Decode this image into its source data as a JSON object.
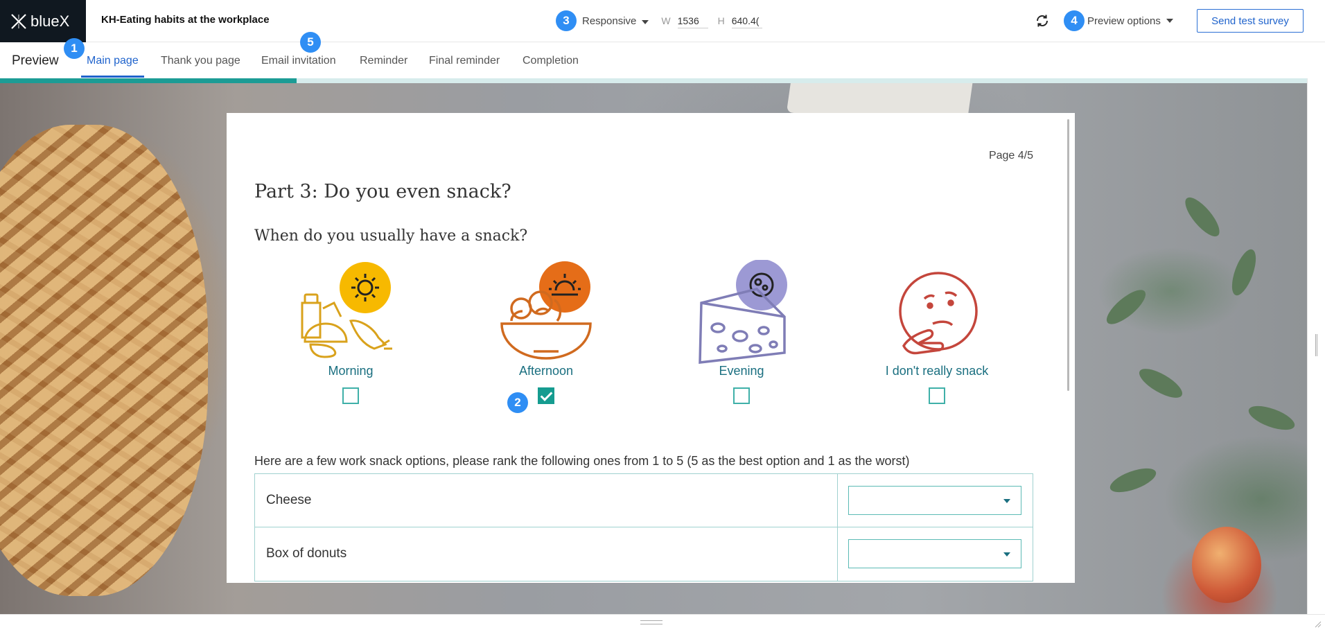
{
  "app": {
    "logo_text": "blueX",
    "survey_title": "KH-Eating habits at the workplace"
  },
  "header": {
    "device_mode": "Responsive",
    "width_label": "W",
    "width_value": "1536",
    "height_label": "H",
    "height_value": "640.4(",
    "preview_options_label": "Preview options",
    "send_test_label": "Send test survey",
    "refresh_icon": "refresh-icon"
  },
  "badges": {
    "b1": "1",
    "b2": "2",
    "b3": "3",
    "b4": "4",
    "b5": "5"
  },
  "tabs": {
    "preview_label": "Preview",
    "items": [
      {
        "label": "Main page",
        "active": true
      },
      {
        "label": "Thank you page",
        "active": false
      },
      {
        "label": "Email invitation",
        "active": false
      },
      {
        "label": "Reminder",
        "active": false
      },
      {
        "label": "Final reminder",
        "active": false
      },
      {
        "label": "Completion",
        "active": false
      }
    ],
    "progress_fraction": 0.224
  },
  "survey": {
    "page_counter": "Page 4/5",
    "part_title": "Part 3: Do you even snack?",
    "question": "When do you usually have a snack?",
    "options": [
      {
        "label": "Morning",
        "checked": false,
        "icon": "groceries-sun-icon",
        "accent": "#f5b400"
      },
      {
        "label": "Afternoon",
        "checked": true,
        "icon": "fruit-bowl-sunset-icon",
        "accent": "#e5731c"
      },
      {
        "label": "Evening",
        "checked": false,
        "icon": "cheese-moon-icon",
        "accent": "#9a98d2"
      },
      {
        "label": "I don't really snack",
        "checked": false,
        "icon": "thinking-face-icon",
        "accent": "#c8473c"
      }
    ],
    "rank_question": "Here are a few work snack options, please rank the following ones from 1 to 5 (5 as the best option and 1 as the worst)",
    "rank_items": [
      {
        "label": "Cheese",
        "value": ""
      },
      {
        "label": "Box of donuts",
        "value": ""
      }
    ]
  },
  "colors": {
    "brand_blue": "#1f63cc",
    "teal": "#169c90",
    "badge_blue": "#2f8ef4",
    "logo_bg": "#101820"
  }
}
